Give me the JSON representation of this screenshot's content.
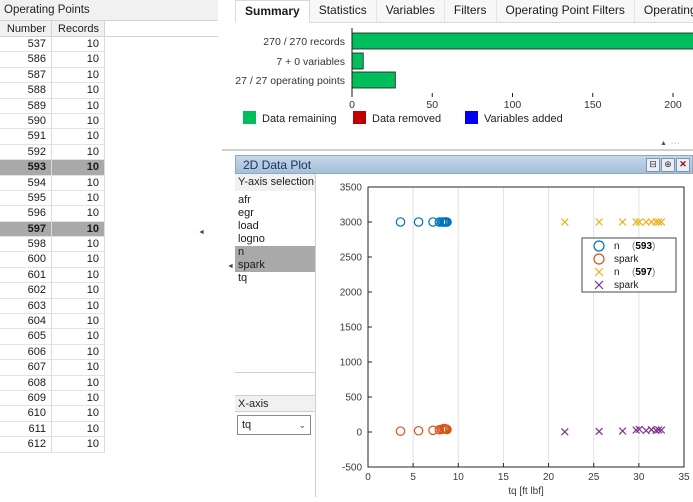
{
  "left_panel": {
    "title": "Operating Points",
    "columns": [
      "Number",
      "Records"
    ],
    "selected_numbers": [
      593,
      597
    ],
    "rows": [
      [
        537,
        10
      ],
      [
        586,
        10
      ],
      [
        587,
        10
      ],
      [
        588,
        10
      ],
      [
        589,
        10
      ],
      [
        590,
        10
      ],
      [
        591,
        10
      ],
      [
        592,
        10
      ],
      [
        593,
        10
      ],
      [
        594,
        10
      ],
      [
        595,
        10
      ],
      [
        596,
        10
      ],
      [
        597,
        10
      ],
      [
        598,
        10
      ],
      [
        600,
        10
      ],
      [
        601,
        10
      ],
      [
        602,
        10
      ],
      [
        603,
        10
      ],
      [
        604,
        10
      ],
      [
        605,
        10
      ],
      [
        606,
        10
      ],
      [
        607,
        10
      ],
      [
        608,
        10
      ],
      [
        609,
        10
      ],
      [
        610,
        10
      ],
      [
        611,
        10
      ],
      [
        612,
        10
      ]
    ]
  },
  "tabs": {
    "labels": [
      "Summary",
      "Statistics",
      "Variables",
      "Filters",
      "Operating Point Filters",
      "Operating Point Notes"
    ],
    "active": "Summary"
  },
  "summary": {
    "legend": [
      {
        "label": "Data remaining",
        "color": "#00be5c"
      },
      {
        "label": "Data removed",
        "color": "#c00000"
      },
      {
        "label": "Variables added",
        "color": "#0000f0"
      }
    ]
  },
  "plot_panel": {
    "title": "2D Data Plot",
    "y_axis_header": "Y-axis selection",
    "x_axis_header": "X-axis selection",
    "y_options": [
      "afr",
      "egr",
      "load",
      "logno",
      "n",
      "spark",
      "tq"
    ],
    "y_selected": [
      "n",
      "spark"
    ],
    "x_selected": "tq",
    "buttons": [
      {
        "name": "minimize",
        "glyph": "⊟"
      },
      {
        "name": "maximize",
        "glyph": "⊕"
      },
      {
        "name": "close",
        "glyph": "✕"
      }
    ]
  },
  "decorations": {
    "collapse_left_glyph": "◄",
    "splitter_handle_glyph": "▲ ···"
  },
  "chart_data": [
    {
      "type": "bar",
      "orientation": "horizontal",
      "title": "",
      "categories": [
        "270 / 270 records",
        "7 + 0 variables",
        "27 / 27 operating points"
      ],
      "values": [
        270,
        7,
        27
      ],
      "bar_color": "#00be5c",
      "xlim": [
        0,
        212
      ],
      "xticks": [
        0,
        50,
        100,
        150,
        200
      ],
      "legend_entries": [
        "Data remaining",
        "Data removed",
        "Variables added"
      ],
      "grid": false
    },
    {
      "type": "scatter",
      "title": "",
      "xlabel": "tq [ft lbf]",
      "ylabel": "",
      "xlim": [
        0,
        35
      ],
      "ylim": [
        -500,
        3500
      ],
      "xticks": [
        0,
        5,
        10,
        15,
        20,
        25,
        30,
        35
      ],
      "yticks": [
        -500,
        0,
        500,
        1000,
        1500,
        2000,
        2500,
        3000,
        3500
      ],
      "grid": "vertical-only",
      "legend_position": "upper-right-inside",
      "series": [
        {
          "name": "n",
          "group": "593",
          "marker": "circle",
          "color": "#0072bd",
          "x": [
            3.6,
            5.6,
            7.2,
            7.9,
            8.15,
            8.3,
            8.45,
            8.55,
            8.65,
            8.75
          ],
          "y": [
            3000,
            3000,
            3000,
            3000,
            3000,
            3000,
            3000,
            3000,
            3000,
            3000
          ]
        },
        {
          "name": "spark",
          "group": "593",
          "marker": "circle",
          "color": "#d95319",
          "x": [
            3.6,
            5.6,
            7.2,
            7.9,
            8.15,
            8.3,
            8.45,
            8.55,
            8.65,
            8.75
          ],
          "y": [
            12,
            18,
            24,
            32,
            38,
            44,
            50,
            46,
            41,
            36
          ]
        },
        {
          "name": "n",
          "group": "597",
          "marker": "x",
          "color": "#edb120",
          "x": [
            21.8,
            25.6,
            28.2,
            29.7,
            30.05,
            30.8,
            31.4,
            31.9,
            32.2,
            32.5
          ],
          "y": [
            3000,
            3000,
            3000,
            3000,
            3000,
            3000,
            3000,
            3000,
            3000,
            3000
          ]
        },
        {
          "name": "spark",
          "group": "597",
          "marker": "x",
          "color": "#7e2f8e",
          "x": [
            21.8,
            25.6,
            28.2,
            29.7,
            30.05,
            30.8,
            31.4,
            31.9,
            32.2,
            32.5
          ],
          "y": [
            2,
            8,
            14,
            28,
            38,
            20,
            33,
            25,
            30,
            27
          ]
        }
      ],
      "legend": [
        {
          "marker": "circle",
          "color": "#0072bd",
          "name": "n",
          "group": "593"
        },
        {
          "marker": "circle",
          "color": "#d95319",
          "name": "spark",
          "group": ""
        },
        {
          "marker": "x",
          "color": "#edb120",
          "name": "n",
          "group": "597"
        },
        {
          "marker": "x",
          "color": "#7e2f8e",
          "name": "spark",
          "group": ""
        }
      ]
    }
  ]
}
